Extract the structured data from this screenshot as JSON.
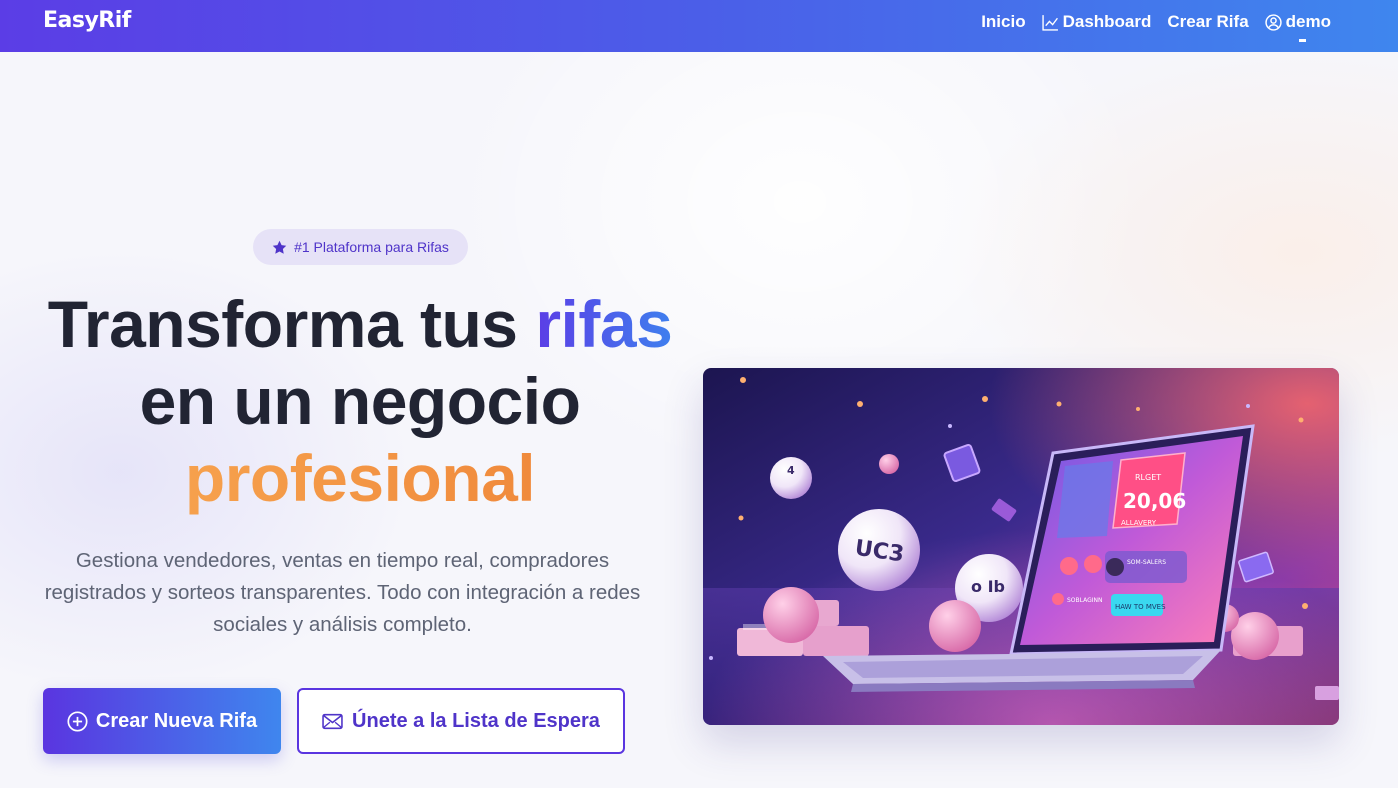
{
  "brand": "EasyRif",
  "nav": {
    "inicio": "Inicio",
    "dashboard": "Dashboard",
    "crear_rifa": "Crear Rifa",
    "user": "demo"
  },
  "hero": {
    "badge": "#1 Plataforma para Rifas",
    "headline_part1": "Transforma tus ",
    "headline_accent": "rifas",
    "headline_part2": "en un negocio",
    "headline_orange": "profesional",
    "subtitle": "Gestiona vendedores, ventas en tiempo real, compradores registrados y sorteos transparentes. Todo con integración a redes sociales y análisis completo.",
    "primary_button": "Crear Nueva Rifa",
    "secondary_button": "Únete a la Lista de Espera"
  },
  "illustration": {
    "card_title": "RLGET",
    "card_value": "20,06",
    "card_sub": "ALLAVERY",
    "row_label": "SOM-SALERS",
    "bottom_label": "SOBLAGINN",
    "cta_label": "HAW TO MVES",
    "ball_text": "UC3"
  },
  "colors": {
    "brand_purple": "#5b3de6",
    "brand_blue": "#3f86ee",
    "accent_orange": "#f29341",
    "text_dark": "#212433"
  }
}
